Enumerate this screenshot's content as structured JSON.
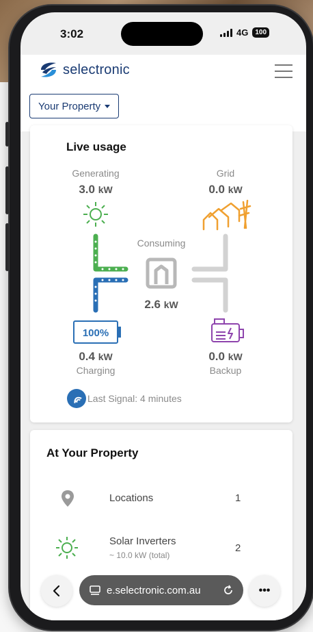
{
  "status": {
    "time": "3:02",
    "network": "4G",
    "battery": "100"
  },
  "brand": {
    "name": "selectronic",
    "color": "#1a3b73"
  },
  "property_button": {
    "label": "Your Property"
  },
  "live": {
    "title": "Live usage",
    "generating": {
      "label": "Generating",
      "value": "3.0",
      "unit": "kW",
      "color": "#4caf50"
    },
    "grid": {
      "label": "Grid",
      "value": "0.0",
      "unit": "kW",
      "color": "#f0a030"
    },
    "consuming": {
      "label": "Consuming",
      "value": "2.6",
      "unit": "kW"
    },
    "battery": {
      "label": "Charging",
      "percent": "100%",
      "value": "0.4",
      "unit": "kW",
      "color": "#2a6fb5"
    },
    "backup": {
      "label": "Backup",
      "value": "0.0",
      "unit": "kW",
      "color": "#8e44ad"
    },
    "signal": "Last Signal: 4 minutes"
  },
  "at_property": {
    "title": "At Your Property",
    "rows": [
      {
        "icon": "location-pin-icon",
        "label": "Locations",
        "sub": "",
        "count": "1"
      },
      {
        "icon": "sun-icon",
        "label": "Solar Inverters",
        "sub": "~ 10.0 kW (total)",
        "count": "2"
      }
    ]
  },
  "browser": {
    "url": "e.selectronic.com.au",
    "more_label": "•••"
  }
}
